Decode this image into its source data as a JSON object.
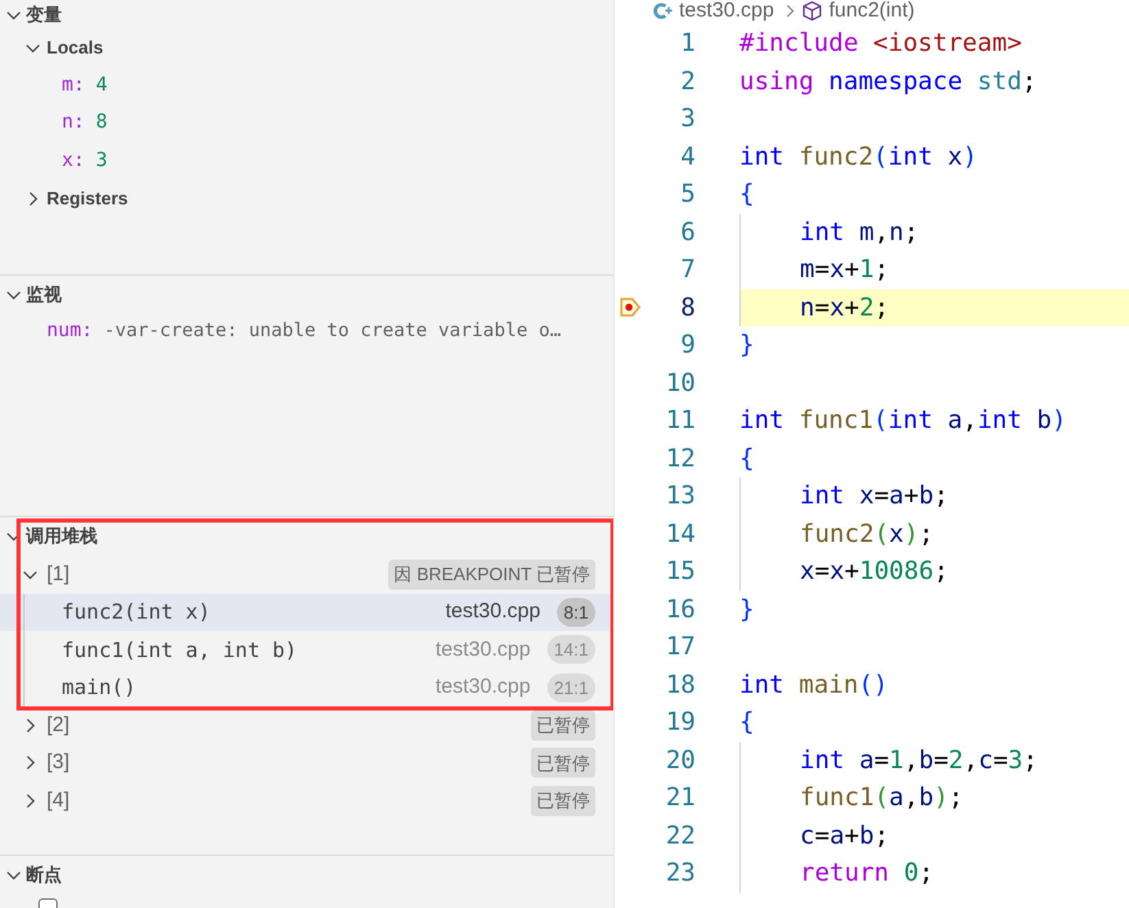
{
  "variables_panel": {
    "title": "变量",
    "expanded": true,
    "scopes": [
      {
        "label": "Locals",
        "expanded": true,
        "variables": [
          {
            "name": "m:",
            "value": "4"
          },
          {
            "name": "n:",
            "value": "8"
          },
          {
            "name": "x:",
            "value": "3"
          }
        ]
      },
      {
        "label": "Registers",
        "expanded": false
      }
    ]
  },
  "watch_panel": {
    "title": "监视",
    "expanded": true,
    "items": [
      {
        "name": "num:",
        "value": "-var-create: unable to create variable o…"
      }
    ]
  },
  "call_stack_panel": {
    "title": "调用堆栈",
    "expanded": true,
    "threads": [
      {
        "label": "[1]",
        "status": "因 BREAKPOINT 已暂停",
        "expanded": true,
        "frames": [
          {
            "function": "func2(int x)",
            "file": "test30.cpp",
            "position": "8:1",
            "selected": true
          },
          {
            "function": "func1(int a, int b)",
            "file": "test30.cpp",
            "position": "14:1",
            "selected": false
          },
          {
            "function": "main()",
            "file": "test30.cpp",
            "position": "21:1",
            "selected": false
          }
        ]
      },
      {
        "label": "[2]",
        "status": "已暂停",
        "expanded": false
      },
      {
        "label": "[3]",
        "status": "已暂停",
        "expanded": false
      },
      {
        "label": "[4]",
        "status": "已暂停",
        "expanded": false
      }
    ]
  },
  "breakpoints_panel": {
    "title": "断点",
    "expanded": true,
    "items": [
      {
        "checked": false
      }
    ]
  },
  "editor": {
    "breadcrumb": [
      {
        "kind": "file",
        "text": "test30.cpp"
      },
      {
        "kind": "symbol",
        "text": "func2(int)"
      }
    ],
    "lines": [
      {
        "number": "1",
        "indented": false,
        "current": false,
        "tokens": [
          {
            "text": "#include",
            "kind": "ctrl"
          },
          {
            "text": " <iostream>",
            "kind": "str"
          }
        ]
      },
      {
        "number": "2",
        "indented": false,
        "current": false,
        "tokens": [
          {
            "text": "using",
            "kind": "ctrl"
          },
          {
            "text": " namespace",
            "kind": "kw"
          },
          {
            "text": " std",
            "kind": "type"
          },
          {
            "text": ";",
            "kind": "plain"
          }
        ]
      },
      {
        "number": "3",
        "indented": false,
        "current": false
      },
      {
        "number": "4",
        "indented": false,
        "current": false,
        "tokens": [
          {
            "text": "int",
            "kind": "kw"
          },
          {
            "text": " func2",
            "kind": "fn"
          },
          {
            "text": "(",
            "kind": "b1"
          },
          {
            "text": "int",
            "kind": "kw"
          },
          {
            "text": " x",
            "kind": "var"
          },
          {
            "text": ")",
            "kind": "b1"
          }
        ]
      },
      {
        "number": "5",
        "indented": false,
        "current": false,
        "tokens": [
          {
            "text": "{",
            "kind": "b1"
          }
        ]
      },
      {
        "number": "6",
        "indented": true,
        "current": false,
        "tokens": [
          {
            "text": "int",
            "kind": "kw"
          },
          {
            "text": " m",
            "kind": "var"
          },
          {
            "text": ",",
            "kind": "plain"
          },
          {
            "text": "n",
            "kind": "var"
          },
          {
            "text": ";",
            "kind": "plain"
          }
        ]
      },
      {
        "number": "7",
        "indented": true,
        "current": false,
        "tokens": [
          {
            "text": "m",
            "kind": "var"
          },
          {
            "text": "=",
            "kind": "plain"
          },
          {
            "text": "x",
            "kind": "var"
          },
          {
            "text": "+",
            "kind": "plain"
          },
          {
            "text": "1",
            "kind": "num"
          },
          {
            "text": ";",
            "kind": "plain"
          }
        ]
      },
      {
        "number": "8",
        "indented": true,
        "current": true,
        "tokens": [
          {
            "text": "n",
            "kind": "var"
          },
          {
            "text": "=",
            "kind": "plain"
          },
          {
            "text": "x",
            "kind": "var"
          },
          {
            "text": "+",
            "kind": "plain"
          },
          {
            "text": "2",
            "kind": "num"
          },
          {
            "text": ";",
            "kind": "plain"
          }
        ]
      },
      {
        "number": "9",
        "indented": false,
        "current": false,
        "tokens": [
          {
            "text": "}",
            "kind": "b1"
          }
        ]
      },
      {
        "number": "10",
        "indented": false,
        "current": false
      },
      {
        "number": "11",
        "indented": false,
        "current": false,
        "tokens": [
          {
            "text": "int",
            "kind": "kw"
          },
          {
            "text": " func1",
            "kind": "fn"
          },
          {
            "text": "(",
            "kind": "b1"
          },
          {
            "text": "int",
            "kind": "kw"
          },
          {
            "text": " a",
            "kind": "var"
          },
          {
            "text": ",",
            "kind": "plain"
          },
          {
            "text": "int",
            "kind": "kw"
          },
          {
            "text": " b",
            "kind": "var"
          },
          {
            "text": ")",
            "kind": "b1"
          }
        ]
      },
      {
        "number": "12",
        "indented": false,
        "current": false,
        "tokens": [
          {
            "text": "{",
            "kind": "b1"
          }
        ]
      },
      {
        "number": "13",
        "indented": true,
        "current": false,
        "tokens": [
          {
            "text": "int",
            "kind": "kw"
          },
          {
            "text": " x",
            "kind": "var"
          },
          {
            "text": "=",
            "kind": "plain"
          },
          {
            "text": "a",
            "kind": "var"
          },
          {
            "text": "+",
            "kind": "plain"
          },
          {
            "text": "b",
            "kind": "var"
          },
          {
            "text": ";",
            "kind": "plain"
          }
        ]
      },
      {
        "number": "14",
        "indented": true,
        "current": false,
        "tokens": [
          {
            "text": "func2",
            "kind": "fn"
          },
          {
            "text": "(",
            "kind": "b2"
          },
          {
            "text": "x",
            "kind": "var"
          },
          {
            "text": ")",
            "kind": "b2"
          },
          {
            "text": ";",
            "kind": "plain"
          }
        ]
      },
      {
        "number": "15",
        "indented": true,
        "current": false,
        "tokens": [
          {
            "text": "x",
            "kind": "var"
          },
          {
            "text": "=",
            "kind": "plain"
          },
          {
            "text": "x",
            "kind": "var"
          },
          {
            "text": "+",
            "kind": "plain"
          },
          {
            "text": "10086",
            "kind": "num"
          },
          {
            "text": ";",
            "kind": "plain"
          }
        ]
      },
      {
        "number": "16",
        "indented": false,
        "current": false,
        "tokens": [
          {
            "text": "}",
            "kind": "b1"
          }
        ]
      },
      {
        "number": "17",
        "indented": false,
        "current": false
      },
      {
        "number": "18",
        "indented": false,
        "current": false,
        "tokens": [
          {
            "text": "int",
            "kind": "kw"
          },
          {
            "text": " main",
            "kind": "fn"
          },
          {
            "text": "()",
            "kind": "b1"
          }
        ]
      },
      {
        "number": "19",
        "indented": false,
        "current": false,
        "tokens": [
          {
            "text": "{",
            "kind": "b1"
          }
        ]
      },
      {
        "number": "20",
        "indented": true,
        "current": false,
        "tokens": [
          {
            "text": "int",
            "kind": "kw"
          },
          {
            "text": " a",
            "kind": "var"
          },
          {
            "text": "=",
            "kind": "plain"
          },
          {
            "text": "1",
            "kind": "num"
          },
          {
            "text": ",",
            "kind": "plain"
          },
          {
            "text": "b",
            "kind": "var"
          },
          {
            "text": "=",
            "kind": "plain"
          },
          {
            "text": "2",
            "kind": "num"
          },
          {
            "text": ",",
            "kind": "plain"
          },
          {
            "text": "c",
            "kind": "var"
          },
          {
            "text": "=",
            "kind": "plain"
          },
          {
            "text": "3",
            "kind": "num"
          },
          {
            "text": ";",
            "kind": "plain"
          }
        ]
      },
      {
        "number": "21",
        "indented": true,
        "current": false,
        "tokens": [
          {
            "text": "func1",
            "kind": "fn"
          },
          {
            "text": "(",
            "kind": "b2"
          },
          {
            "text": "a",
            "kind": "var"
          },
          {
            "text": ",",
            "kind": "plain"
          },
          {
            "text": "b",
            "kind": "var"
          },
          {
            "text": ")",
            "kind": "b2"
          },
          {
            "text": ";",
            "kind": "plain"
          }
        ]
      },
      {
        "number": "22",
        "indented": true,
        "current": false,
        "tokens": [
          {
            "text": "c",
            "kind": "var"
          },
          {
            "text": "=",
            "kind": "plain"
          },
          {
            "text": "a",
            "kind": "var"
          },
          {
            "text": "+",
            "kind": "plain"
          },
          {
            "text": "b",
            "kind": "var"
          },
          {
            "text": ";",
            "kind": "plain"
          }
        ]
      },
      {
        "number": "23",
        "indented": true,
        "current": false,
        "tokens": [
          {
            "text": "return",
            "kind": "ctrl"
          },
          {
            "text": " 0",
            "kind": "num"
          },
          {
            "text": ";",
            "kind": "plain"
          }
        ]
      }
    ]
  }
}
